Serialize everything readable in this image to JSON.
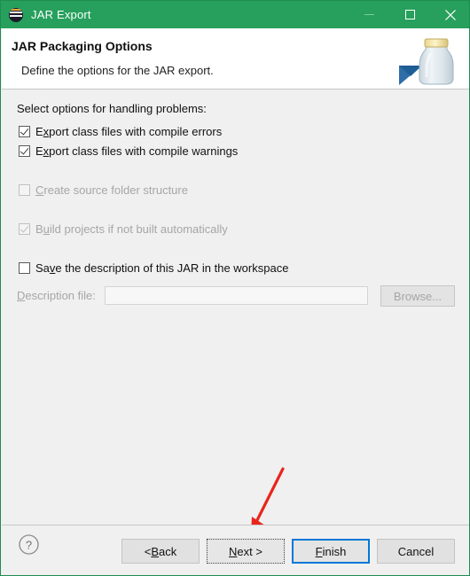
{
  "window": {
    "title": "JAR Export",
    "icon": "jar-export-icon",
    "titlebar_color": "#26a05c",
    "controls": {
      "minimize": "minimize-icon",
      "maximize": "maximize-icon",
      "close": "close-icon"
    }
  },
  "header": {
    "title": "JAR Packaging Options",
    "subtitle": "Define the options for the JAR export.",
    "banner_icon": "jar-banner-icon"
  },
  "main": {
    "intro_label": "Select options for handling problems:",
    "options": [
      {
        "label": "Export class files with compile errors",
        "mnemonic_pre": "E",
        "mnemonic": "x",
        "mnemonic_post": "port class files with compile errors",
        "checked": true,
        "disabled": false
      },
      {
        "label": "Export class files with compile warnings",
        "mnemonic_pre": "E",
        "mnemonic": "x",
        "mnemonic_post": "port class files with compile warnings",
        "checked": true,
        "disabled": false
      },
      {
        "label": "Create source folder structure",
        "mnemonic_pre": "",
        "mnemonic": "C",
        "mnemonic_post": "reate source folder structure",
        "checked": false,
        "disabled": true
      },
      {
        "label": "Build projects if not built automatically",
        "mnemonic_pre": "B",
        "mnemonic": "u",
        "mnemonic_post": "ild projects if not built automatically",
        "checked": true,
        "disabled": true
      },
      {
        "label": "Save the description of this JAR in the workspace",
        "mnemonic_pre": "Sa",
        "mnemonic": "v",
        "mnemonic_post": "e the description of this JAR in the workspace",
        "checked": false,
        "disabled": false
      }
    ],
    "description_file": {
      "label_pre": "",
      "label_mnemonic": "D",
      "label_post": "escription file:",
      "value": "",
      "placeholder": "",
      "disabled": true,
      "browse_pre": "B",
      "browse_mnemonic": "r",
      "browse_post": "owse...",
      "browse_label": "Browse..."
    }
  },
  "footer": {
    "help_icon": "help-circle-icon",
    "buttons": [
      {
        "label": "< Back",
        "pre": "< ",
        "mnemonic": "B",
        "post": "ack",
        "state": "normal"
      },
      {
        "label": "Next >",
        "pre": "",
        "mnemonic": "N",
        "post": "ext >",
        "state": "focused"
      },
      {
        "label": "Finish",
        "pre": "",
        "mnemonic": "F",
        "post": "inish",
        "state": "default"
      },
      {
        "label": "Cancel",
        "pre": "",
        "mnemonic": "",
        "post": "Cancel",
        "state": "normal"
      }
    ]
  },
  "annotation": {
    "arrow_color": "#e8251c",
    "arrow_target": "Next >"
  }
}
